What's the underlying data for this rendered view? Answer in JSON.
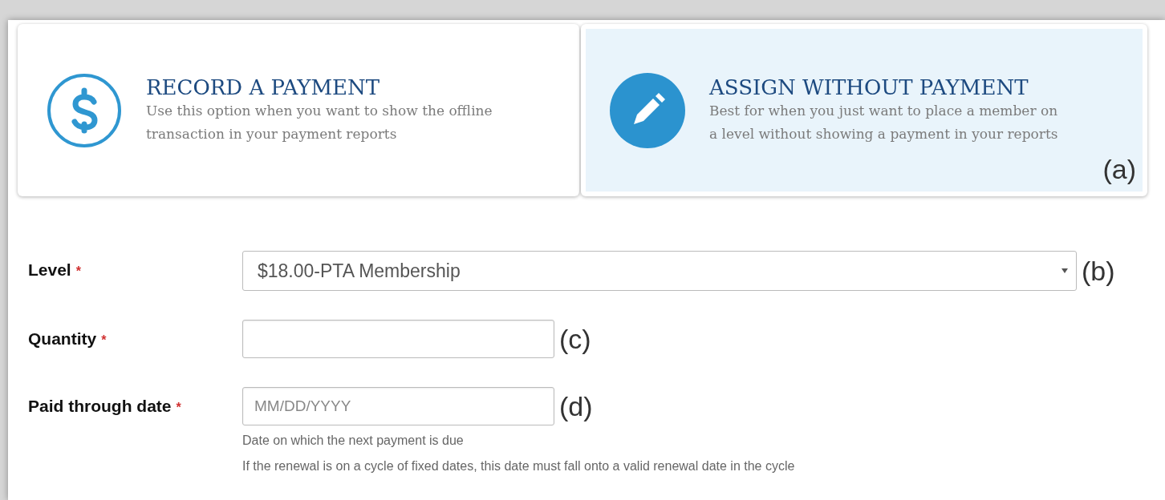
{
  "options": [
    {
      "kind": "payment",
      "title": "RECORD A PAYMENT",
      "description": "Use this option when you want to show the offline transaction in your payment reports",
      "selected": false
    },
    {
      "kind": "assign",
      "title": "ASSIGN WITHOUT PAYMENT",
      "description": "Best for when you just want to place a member on a level without showing a payment in your reports",
      "selected": true,
      "annotation": "(a)"
    }
  ],
  "form": {
    "fields": [
      {
        "kind": "select",
        "label": "Level",
        "required_mark": "*",
        "value": "$18.00-PTA Membership",
        "annotation": "(b)"
      },
      {
        "kind": "input",
        "label": "Quantity",
        "required_mark": "*",
        "annotation": "(c)"
      },
      {
        "kind": "input",
        "label": "Paid through date",
        "required_mark": "*",
        "placeholder": "MM/DD/YYYY",
        "annotation": "(d)",
        "hints": [
          "Date on which the next payment is due",
          "If the renewal is on a cycle of fixed dates, this date must fall onto a valid renewal date in the cycle"
        ]
      }
    ]
  }
}
